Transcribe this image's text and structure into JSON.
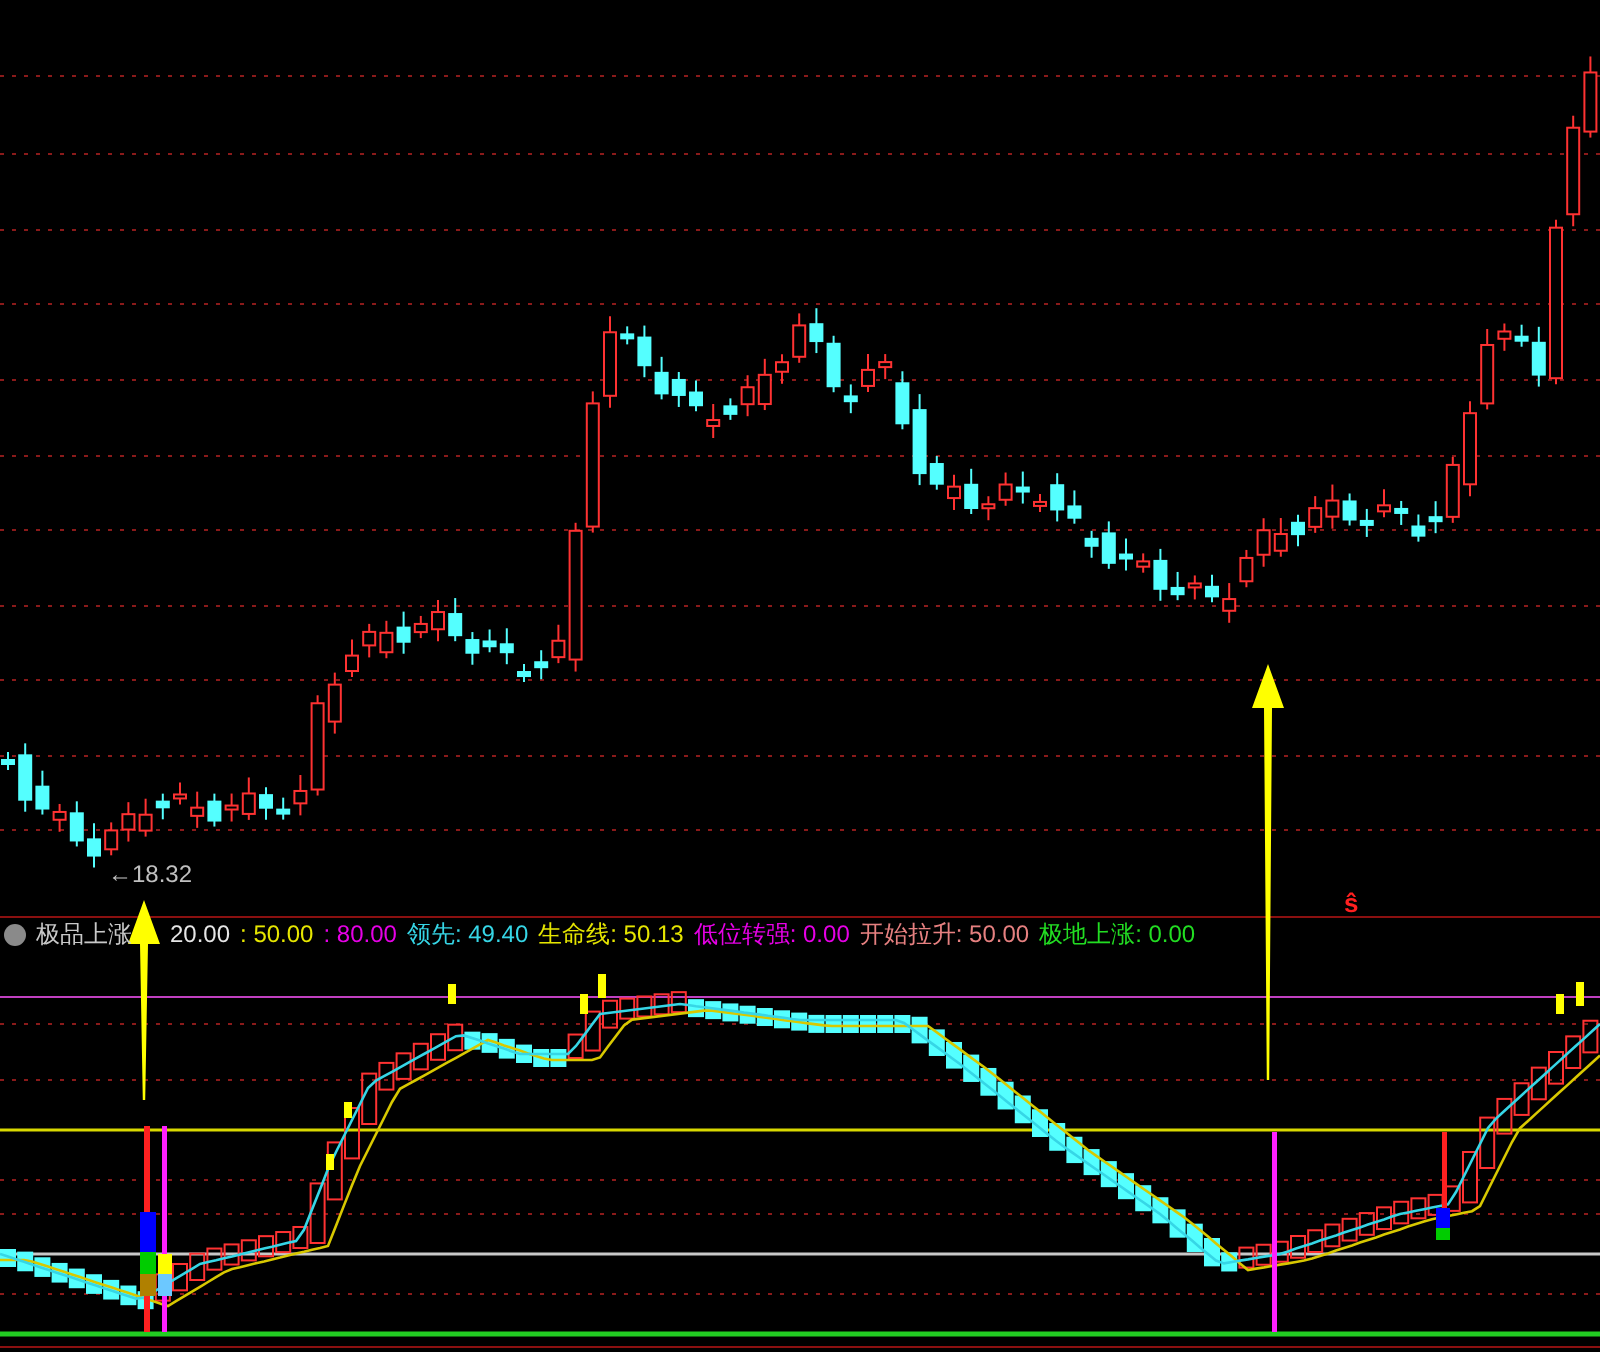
{
  "price_panel": {
    "low_label": "←18.32",
    "marker": "ŝ"
  },
  "indicator_legend": {
    "title": "极品上涨",
    "items": [
      {
        "text": "20.00",
        "color": "#e6e6e6"
      },
      {
        "text": ": 50.00",
        "color": "#e6e600"
      },
      {
        "text": ": 80.00",
        "color": "#e600e6"
      },
      {
        "text": "领先: 49.40",
        "color": "#36d6e6"
      },
      {
        "text": "生命线: 50.13",
        "color": "#e6e600"
      },
      {
        "text": "低位转强: 0.00",
        "color": "#e600e6"
      },
      {
        "text": "开始拉升: 50.00",
        "color": "#e68080"
      },
      {
        "text": "极地上涨: 0.00",
        "color": "#22dd22"
      }
    ]
  }
}
